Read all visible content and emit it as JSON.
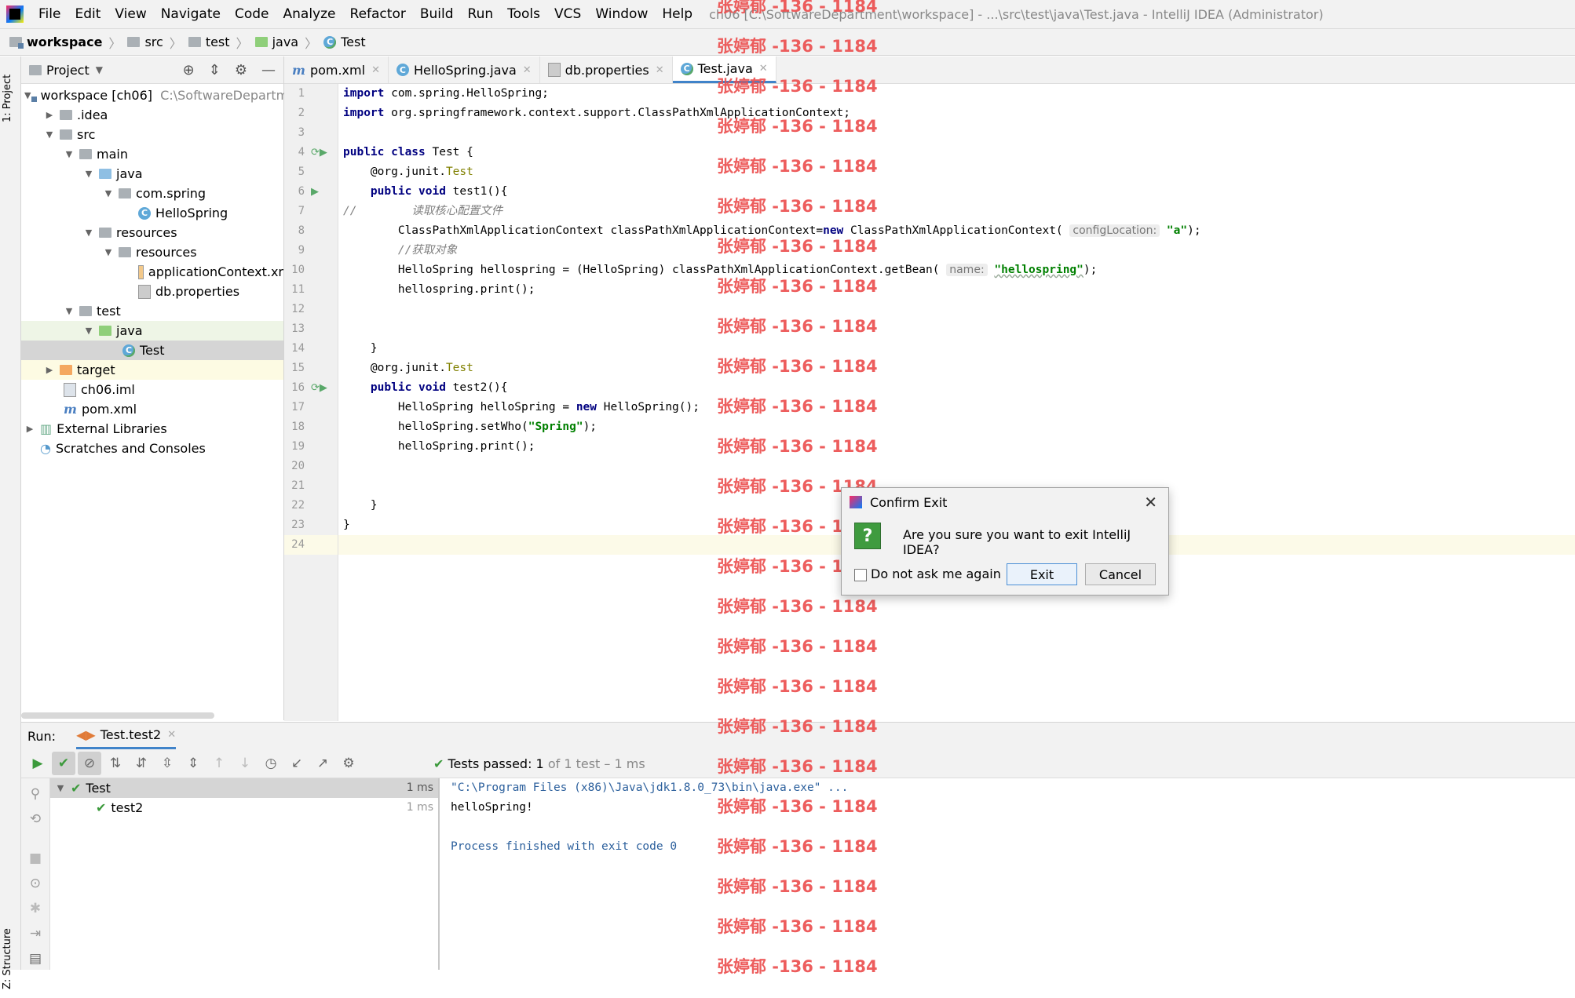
{
  "menu": {
    "items": [
      "File",
      "Edit",
      "View",
      "Navigate",
      "Code",
      "Analyze",
      "Refactor",
      "Build",
      "Run",
      "Tools",
      "VCS",
      "Window",
      "Help"
    ],
    "window_title": "ch06 [C:\\SoftwareDepartment\\workspace] - ...\\src\\test\\java\\Test.java - IntelliJ IDEA (Administrator)"
  },
  "breadcrumb": [
    "workspace",
    "src",
    "test",
    "java",
    "Test"
  ],
  "left_strip": {
    "project_tab": "1: Project",
    "structure_tab": "Z: Structure"
  },
  "project_panel": {
    "title": "Project",
    "tree": [
      {
        "label": "workspace [ch06]",
        "extra": "C:\\SoftwareDepartm"
      },
      {
        "label": ".idea"
      },
      {
        "label": "src"
      },
      {
        "label": "main"
      },
      {
        "label": "java"
      },
      {
        "label": "com.spring"
      },
      {
        "label": "HelloSpring"
      },
      {
        "label": "resources"
      },
      {
        "label": "resources"
      },
      {
        "label": "applicationContext.xr"
      },
      {
        "label": "db.properties"
      },
      {
        "label": "test"
      },
      {
        "label": "java"
      },
      {
        "label": "Test"
      },
      {
        "label": "target"
      },
      {
        "label": "ch06.iml"
      },
      {
        "label": "pom.xml"
      },
      {
        "label": "External Libraries"
      },
      {
        "label": "Scratches and Consoles"
      }
    ]
  },
  "editor_tabs": [
    {
      "label": "pom.xml"
    },
    {
      "label": "HelloSpring.java"
    },
    {
      "label": "db.properties"
    },
    {
      "label": "Test.java"
    }
  ],
  "code": {
    "line_numbers": [
      "1",
      "2",
      "3",
      "4",
      "5",
      "6",
      "7",
      "8",
      "9",
      "10",
      "11",
      "12",
      "13",
      "14",
      "15",
      "16",
      "17",
      "18",
      "19",
      "20",
      "21",
      "22",
      "23",
      "24"
    ],
    "l1_kw": "import",
    "l1_rest": " com.spring.HelloSpring;",
    "l2_kw": "import",
    "l2_rest": " org.springframework.context.support.ClassPathXmlApplicationContext;",
    "l4_kw": "public class",
    "l4_rest": " Test {",
    "l5_at": "@org.junit.",
    "l5_ann": "Test",
    "l6_kw": "public void",
    "l6_rest": " test1(){",
    "l7_comment": "//        读取核心配置文件",
    "l8_a": "ClassPathXmlApplicationContext classPathXmlApplicationContext=",
    "l8_new": "new",
    "l8_b": " ClassPathXmlApplicationContext(",
    "l8_hint": "configLocation:",
    "l8_str": "\"a\"",
    "l8_end": ");",
    "l9_comment": "//获取对象",
    "l10_a": "HelloSpring hellospring = (HelloSpring) classPathXmlApplicationContext.getBean(",
    "l10_hint": "name:",
    "l10_str": "\"hellospring\"",
    "l10_end": ");",
    "l11": "hellospring.print();",
    "l14": "}",
    "l15_at": "@org.junit.",
    "l15_ann": "Test",
    "l16_kw": "public void",
    "l16_rest": " test2(){",
    "l17_a": "HelloSpring helloSpring = ",
    "l17_new": "new",
    "l17_b": " HelloSpring();",
    "l18_a": "helloSpring.setWho(",
    "l18_str": "\"Spring\"",
    "l18_end": ");",
    "l19": "helloSpring.print();",
    "l22": "}",
    "l23": "}"
  },
  "run_panel": {
    "label": "Run:",
    "tab": "Test.test2",
    "status_prefix": "Tests passed:",
    "status_count": "1",
    "status_suffix": "of 1 test – 1 ms",
    "tree": [
      {
        "label": "Test",
        "time": "1 ms"
      },
      {
        "label": "test2",
        "time": "1 ms"
      }
    ],
    "console": [
      "\"C:\\Program Files (x86)\\Java\\jdk1.8.0_73\\bin\\java.exe\" ...",
      "helloSpring!",
      "",
      "Process finished with exit code 0"
    ]
  },
  "dialog": {
    "title": "Confirm Exit",
    "message": "Are you sure you want to exit IntelliJ IDEA?",
    "checkbox": "Do not ask me again",
    "exit_button": "Exit",
    "cancel_button": "Cancel"
  },
  "watermark": "张婷郁 -136 - 1184",
  "colors": {
    "accent": "#4083c9",
    "pass": "#3c9a3c",
    "keyword": "#000080",
    "string": "#008000",
    "annotation": "#808000",
    "watermark": "#ec4c4c"
  }
}
